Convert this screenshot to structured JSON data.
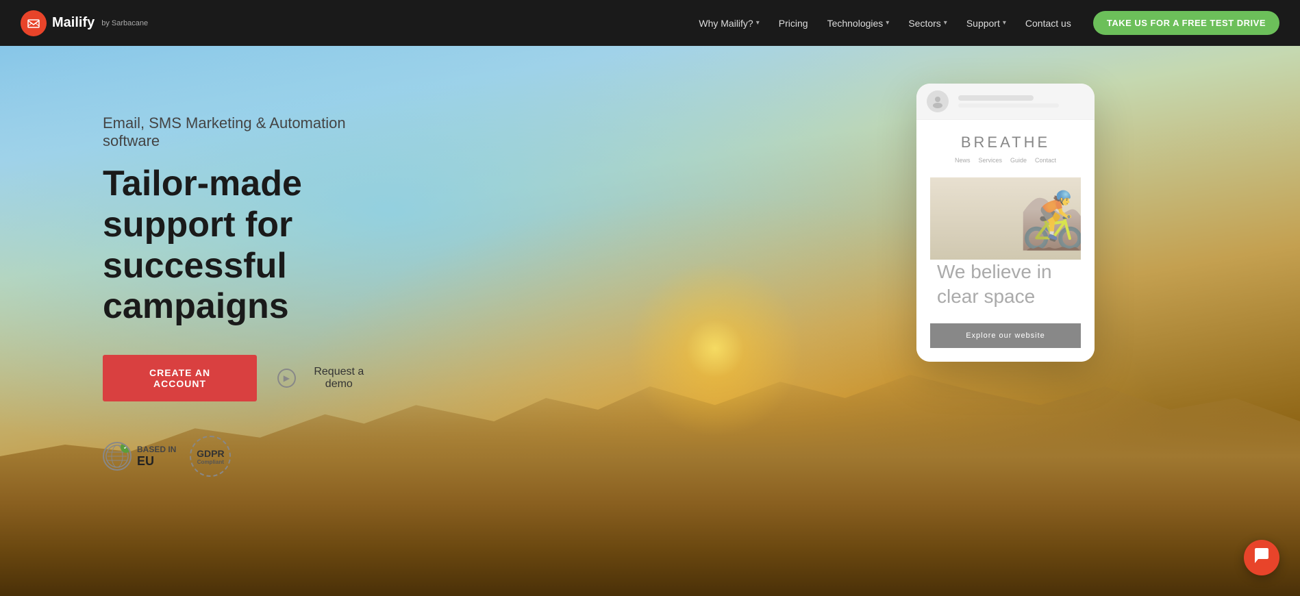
{
  "navbar": {
    "logo_text": "Mailify",
    "logo_icon": "M",
    "logo_sub": "by Sarbacane",
    "nav_items": [
      {
        "label": "Why Mailify?",
        "has_dropdown": true
      },
      {
        "label": "Pricing",
        "has_dropdown": false
      },
      {
        "label": "Technologies",
        "has_dropdown": true
      },
      {
        "label": "Sectors",
        "has_dropdown": true
      },
      {
        "label": "Support",
        "has_dropdown": true
      },
      {
        "label": "Contact us",
        "has_dropdown": false
      }
    ],
    "cta_label": "TAKE US FOR A FREE TEST DRIVE"
  },
  "hero": {
    "subtitle": "Email, SMS Marketing & Automation software",
    "title_line1": "Tailor-made support for successful",
    "title_line2": "campaigns",
    "btn_create": "CREATE AN ACCOUNT",
    "btn_demo": "Request a demo",
    "badge_based_in": "BASED IN",
    "badge_eu": "EU",
    "badge_gdpr": "GDPR",
    "badge_gdpr_sub": "Compliant"
  },
  "phone_mockup": {
    "site_name": "BREATHE",
    "nav_items": [
      "News",
      "Services",
      "Guide",
      "Contact"
    ],
    "body_text": "We believe in clear space",
    "cta_text": "Explore our website"
  },
  "chat": {
    "icon": "💬"
  }
}
